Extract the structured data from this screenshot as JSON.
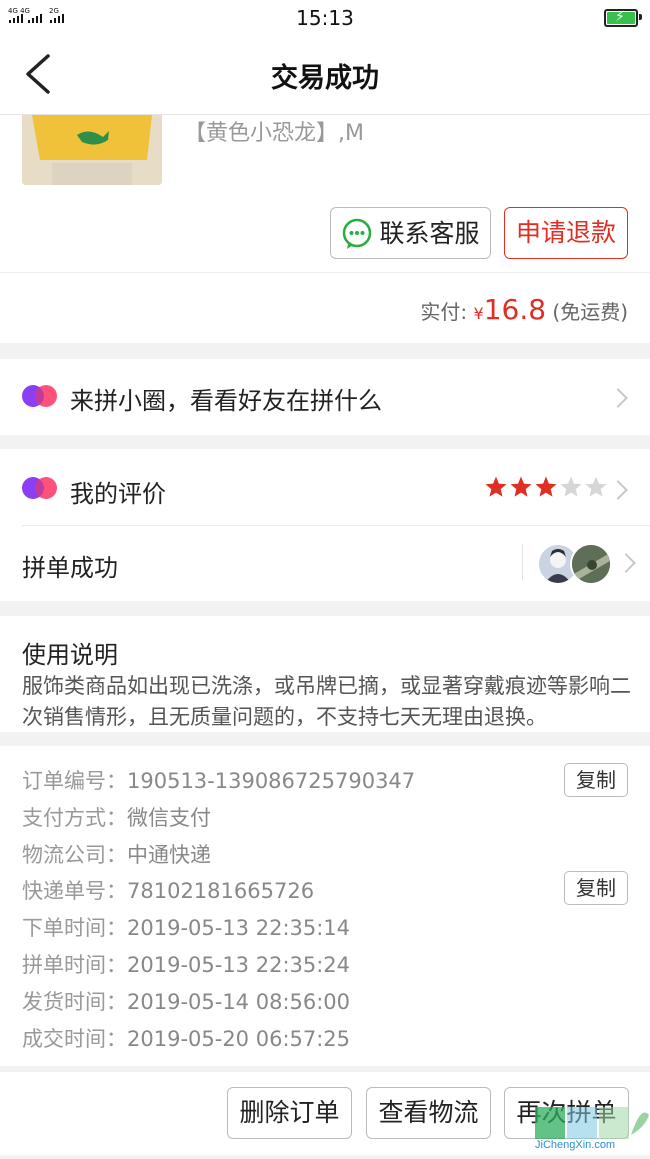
{
  "status_bar": {
    "network_1": "4G 4G",
    "network_2": "2G",
    "time": "15:13"
  },
  "nav": {
    "title": "交易成功"
  },
  "product": {
    "spec": "【黄色小恐龙】,M"
  },
  "actions": {
    "contact_service": "联系客服",
    "request_refund": "申请退款"
  },
  "payment": {
    "label": "实付:",
    "currency": "¥",
    "amount": "16.8",
    "note": "(免运费)"
  },
  "circle": {
    "label": "来拼小圈，看看好友在拼什么"
  },
  "review": {
    "label": "我的评价",
    "rating": 3,
    "max_rating": 5
  },
  "group": {
    "label": "拼单成功"
  },
  "usage": {
    "title": "使用说明",
    "body": "服饰类商品如出现已洗涤，或吊牌已摘，或显著穿戴痕迹等影响二次销售情形，且无质量问题的，不支持七天无理由退换。"
  },
  "order_info": {
    "copy_label": "复制",
    "rows": [
      {
        "label": "订单编号：",
        "value": "190513-139086725790347"
      },
      {
        "label": "支付方式：",
        "value": "微信支付"
      },
      {
        "label": "物流公司：",
        "value": "中通快递"
      },
      {
        "label": "快递单号：",
        "value": "78102181665726"
      },
      {
        "label": "下单时间：",
        "value": "2019-05-13 22:35:14"
      },
      {
        "label": "拼单时间：",
        "value": "2019-05-13 22:35:24"
      },
      {
        "label": "发货时间：",
        "value": "2019-05-14 08:56:00"
      },
      {
        "label": "成交时间：",
        "value": "2019-05-20 06:57:25"
      }
    ]
  },
  "bottom_actions": {
    "delete_order": "删除订单",
    "view_logistics": "查看物流",
    "reorder": "再次拼单"
  },
  "watermark": {
    "text": "JiChengXin.com"
  },
  "colors": {
    "accent_red": "#e02e24",
    "star_red": "#e02e24",
    "star_grey": "#d6d6d6",
    "wechat_green": "#2aae3f"
  }
}
